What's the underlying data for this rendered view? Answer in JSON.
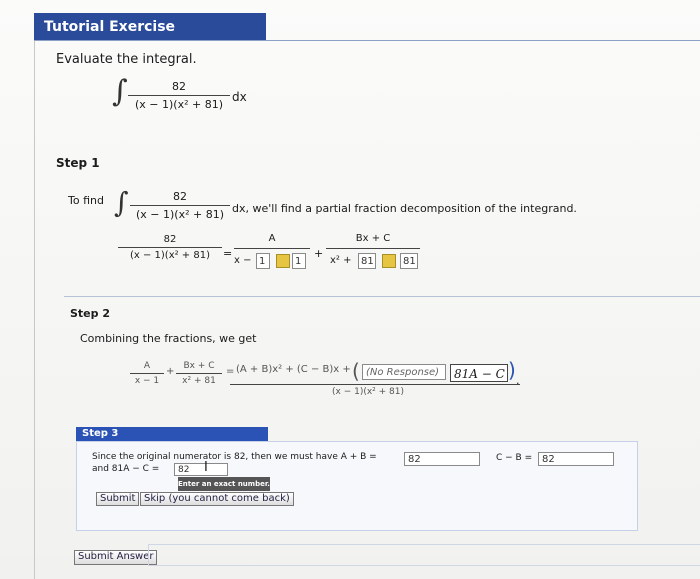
{
  "header": {
    "title": "Tutorial Exercise"
  },
  "prompt": {
    "text": "Evaluate the integral.",
    "numerator": "82",
    "denominator": "(x − 1)(x² + 81)",
    "dx": "dx"
  },
  "step1": {
    "label": "Step 1",
    "to_find": "To find",
    "numerator": "82",
    "denominator": "(x − 1)(x² + 81)",
    "sentence": "dx, we'll find a partial fraction decomposition of the integrand.",
    "pf_lhs_num": "82",
    "pf_lhs_den": "(x − 1)(x² + 81)",
    "eq": "=",
    "a_num": "A",
    "a_den_prefix": "x −",
    "a_input": "1",
    "a_answer": "1",
    "plus": "+",
    "b_num": "Bx + C",
    "b_den_prefix": "x² +",
    "b_input": "81",
    "b_answer": "81"
  },
  "step2": {
    "label": "Step 2",
    "text": "Combining the fractions, we get",
    "f1_num": "A",
    "f1_den": "x − 1",
    "plus": "+",
    "f2_num": "Bx + C",
    "f2_den": "x² + 81",
    "eq": "=",
    "rhs_num": "(A + B)x² + (C − B)x +",
    "no_response": "(No Response)",
    "handwritten": "81A − C",
    "rhs_den": "(x − 1)(x² + 81)",
    "period": "."
  },
  "step3": {
    "label": "Step 3",
    "text": "Since the original numerator is 82, then we must have A + B =",
    "ab_value": "82",
    "cb_label": "C − B =",
    "cb_value": "82",
    "line2_prefix": "and 81A − C =",
    "ac_value": "82",
    "tooltip": "Enter an exact number.",
    "submit": "Submit",
    "skip": "Skip (you cannot come back)"
  },
  "footer": {
    "submit_answer": "Submit Answer"
  }
}
